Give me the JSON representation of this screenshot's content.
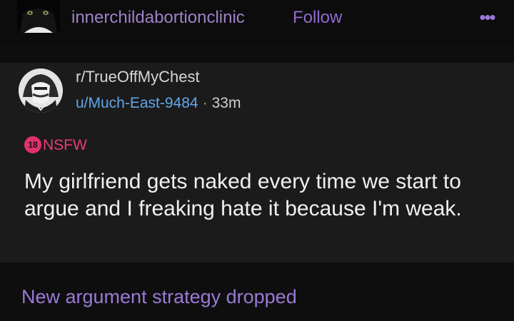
{
  "header": {
    "blog_name": "innerchildabortionclinic",
    "follow_label": "Follow",
    "more_icon": "ellipsis-icon"
  },
  "reddit_post": {
    "subreddit": "r/TrueOffMyChest",
    "username": "u/Much-East-9484",
    "separator": "·",
    "time": "33m",
    "nsfw_badge": "18",
    "nsfw_label": "NSFW",
    "title": "My girlfriend gets naked every time we start to argue and I freaking hate it because I'm weak."
  },
  "caption": "New argument strategy dropped",
  "colors": {
    "background": "#0e0e0e",
    "card": "#1b1b1b",
    "accent_purple": "#8f6ccf",
    "username_blue": "#62a6e8",
    "nsfw_pink": "#e0316f"
  }
}
